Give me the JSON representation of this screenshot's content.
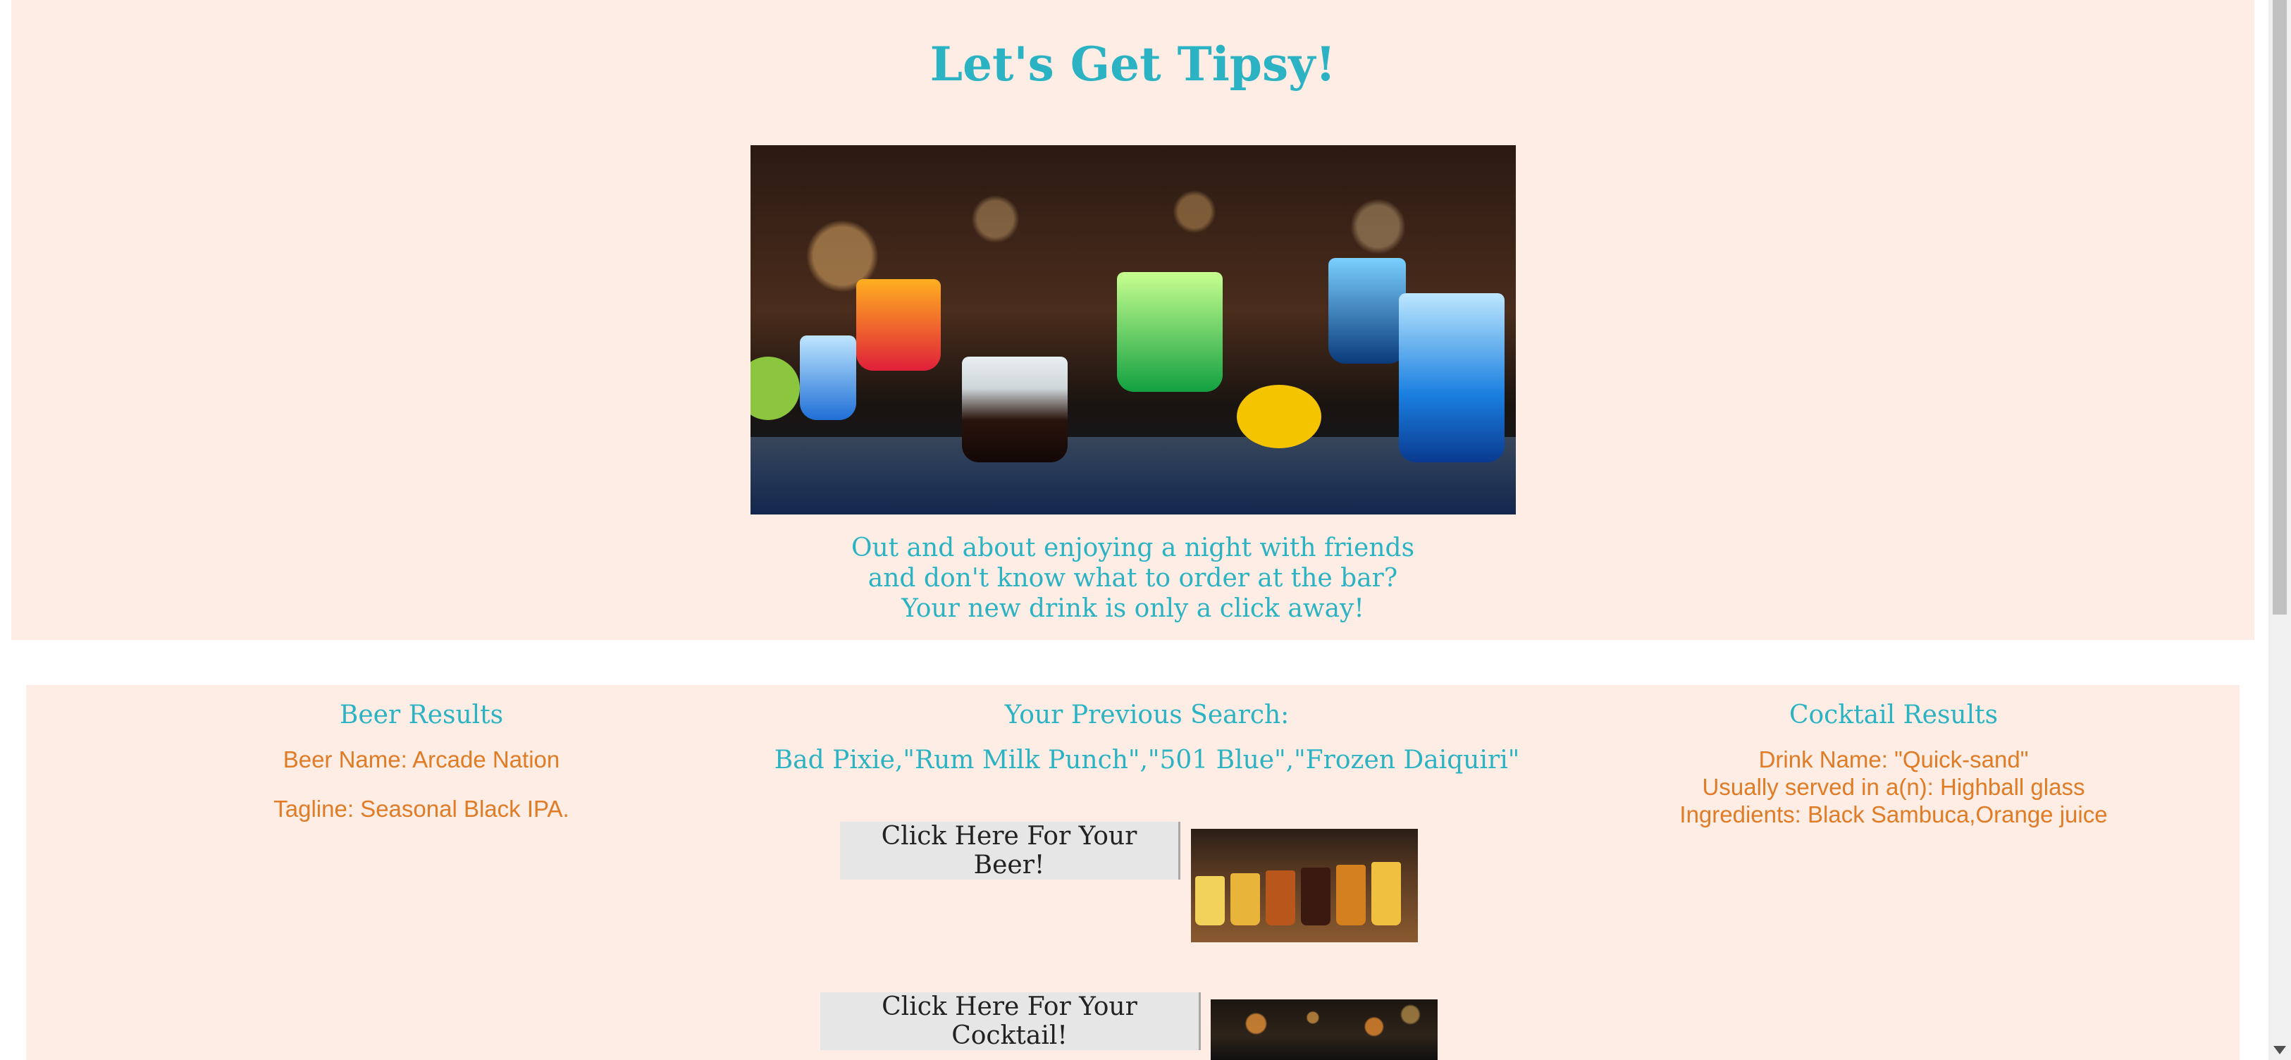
{
  "hero": {
    "title": "Let's Get Tipsy!",
    "image_alt": "Colorful cocktails on a bar",
    "tagline": [
      "Out and about enjoying a night with friends",
      "and don't know what to order at the bar?",
      "Your new drink is only a click away!"
    ]
  },
  "beer": {
    "heading": "Beer Results",
    "name_line": "Beer Name: Arcade Nation",
    "tagline_line": "Tagline: Seasonal Black IPA."
  },
  "previous": {
    "heading": "Your Previous Search:",
    "value": "Bad Pixie,\"Rum Milk Punch\",\"501 Blue\",\"Frozen Daiquiri\""
  },
  "cocktail": {
    "heading": "Cocktail Results",
    "lines": [
      "Drink Name: \"Quick-sand\"",
      "Usually served in a(n): Highball glass",
      "Ingredients: Black Sambuca,Orange juice"
    ]
  },
  "buttons": {
    "beer_label": "Click Here For Your Beer!",
    "cocktail_label": "Click Here For Your Cocktail!"
  },
  "colors": {
    "panel_bg": "#fdede4",
    "teal": "#2bb3c4",
    "orange": "#e07b26"
  }
}
